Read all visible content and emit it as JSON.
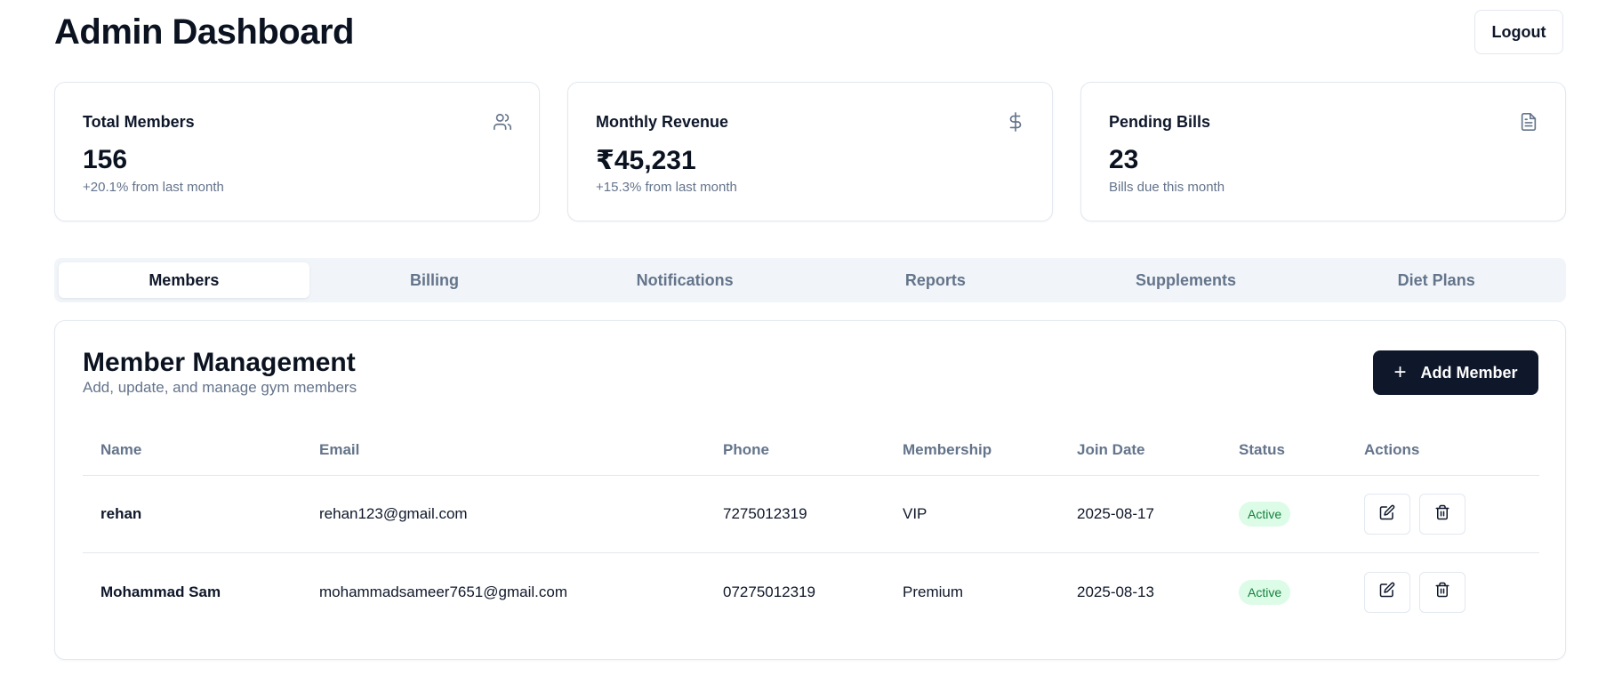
{
  "header": {
    "title": "Admin Dashboard",
    "logout_label": "Logout"
  },
  "stats": [
    {
      "label": "Total Members",
      "value": "156",
      "sub": "+20.1% from last month",
      "icon": "users-icon"
    },
    {
      "label": "Monthly Revenue",
      "value": "₹45,231",
      "sub": "+15.3% from last month",
      "icon": "dollar-icon"
    },
    {
      "label": "Pending Bills",
      "value": "23",
      "sub": "Bills due this month",
      "icon": "file-text-icon"
    }
  ],
  "tabs": [
    {
      "label": "Members",
      "active": true
    },
    {
      "label": "Billing",
      "active": false
    },
    {
      "label": "Notifications",
      "active": false
    },
    {
      "label": "Reports",
      "active": false
    },
    {
      "label": "Supplements",
      "active": false
    },
    {
      "label": "Diet Plans",
      "active": false
    }
  ],
  "section": {
    "title": "Member Management",
    "description": "Add, update, and manage gym members",
    "add_button_label": "Add Member"
  },
  "table": {
    "columns": [
      "Name",
      "Email",
      "Phone",
      "Membership",
      "Join Date",
      "Status",
      "Actions"
    ],
    "rows": [
      {
        "name": "rehan",
        "email": "rehan123@gmail.com",
        "phone": "7275012319",
        "membership": "VIP",
        "join_date": "2025-08-17",
        "status": "Active"
      },
      {
        "name": "Mohammad Sam",
        "email": "mohammadsameer7651@gmail.com",
        "phone": "07275012319",
        "membership": "Premium",
        "join_date": "2025-08-13",
        "status": "Active"
      }
    ]
  },
  "colors": {
    "primary": "#0f172a",
    "muted": "#64748b",
    "border": "#e2e8f0",
    "tab_bg": "#f1f5f9",
    "status_active_bg": "#dcfce7",
    "status_active_fg": "#15803d"
  }
}
